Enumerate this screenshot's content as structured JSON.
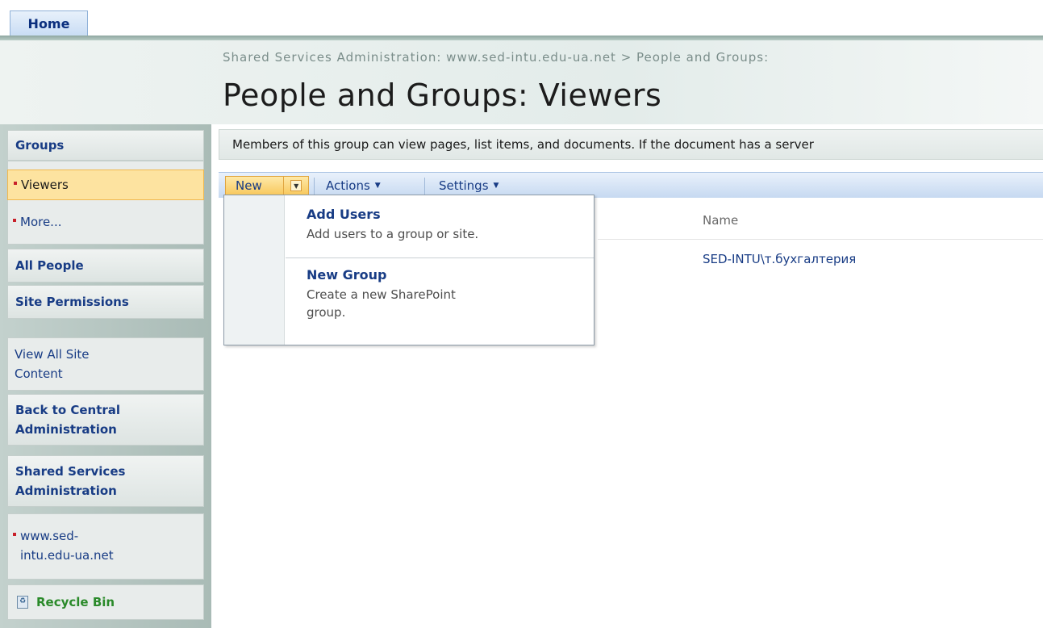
{
  "tabs": {
    "home": "Home"
  },
  "breadcrumb": "Shared Services Administration: www.sed-intu.edu-ua.net > People and Groups:",
  "page_title": "People and Groups: Viewers",
  "sidebar": {
    "groups_heading": "Groups",
    "viewers": "Viewers",
    "more": "More...",
    "all_people": "All People",
    "site_permissions": "Site Permissions",
    "view_all_line1": "View All Site",
    "view_all_line2": "Content",
    "back_line1": "Back to Central",
    "back_line2": "Administration",
    "shared_line1": "Shared Services",
    "shared_line2": "Administration",
    "site_line1": "www.sed-",
    "site_line2": "intu.edu-ua.net",
    "recycle_bin": "Recycle Bin"
  },
  "description": "Members of this group can view pages, list items, and documents. If the document has a server",
  "toolbar": {
    "new": "New",
    "actions": "Actions",
    "settings": "Settings"
  },
  "menu": {
    "add_users_title": "Add Users",
    "add_users_desc": "Add users to a group or site.",
    "new_group_title": "New Group",
    "new_group_desc_line1": "Create a new SharePoint",
    "new_group_desc_line2": "group."
  },
  "list": {
    "name_header": "Name",
    "members": [
      "SED-INTU\\т.бухгалтерия"
    ]
  },
  "colors": {
    "link": "#183c85",
    "selected_bg": "#fde3a0",
    "bullet": "#c8202a",
    "recycle_green": "#2a8a2a"
  }
}
